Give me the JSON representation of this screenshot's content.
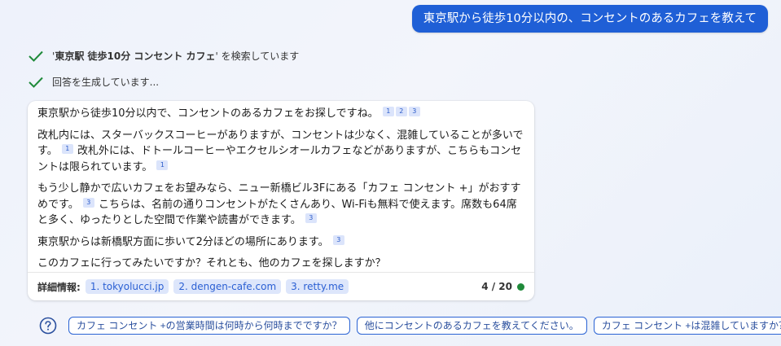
{
  "user_message": "東京駅から徒歩10分以内の、コンセントのあるカフェを教えて",
  "status": {
    "search_query": "東京駅 徒歩10分 コンセント カフェ",
    "search_prefix": "'",
    "search_suffix": "' を検索しています",
    "generating": "回答を生成しています..."
  },
  "answer": {
    "p1": "東京駅から徒歩10分以内で、コンセントのあるカフェをお探しですね。",
    "p2a": "改札内には、スターバックスコーヒーがありますが、コンセントは少なく、混雑していることが多いです。",
    "p2b": "改札外には、ドトールコーヒーやエクセルシオールカフェなどがありますが、こちらもコンセントは限られています。",
    "p3a": "もう少し静かで広いカフェをお望みなら、ニュー新橋ビル3Fにある「カフェ コンセント +」がおすすめです。",
    "p3b": "こちらは、名前の通りコンセントがたくさんあり、Wi-Fiも無料で使えます。席数も64席と多く、ゆったりとした空間で作業や読書ができます。",
    "p4": "東京駅からは新橋駅方面に歩いて2分ほどの場所にあります。",
    "p5": "このカフェに行ってみたいですか？それとも、他のカフェを探しますか？",
    "cites": [
      "1",
      "2",
      "3"
    ]
  },
  "footer": {
    "label": "詳細情報:",
    "sources": [
      "1. tokyolucci.jp",
      "2. dengen-cafe.com",
      "3. retty.me"
    ],
    "counter": "4 / 20"
  },
  "suggestions": [
    "カフェ コンセント +の営業時間は何時から何時までですか？",
    "他にコンセントのあるカフェを教えてください。",
    "カフェ コンセント +は混雑していますか？"
  ],
  "colors": {
    "accent": "#1f5fd6",
    "status_ok": "#1f8a3a"
  }
}
